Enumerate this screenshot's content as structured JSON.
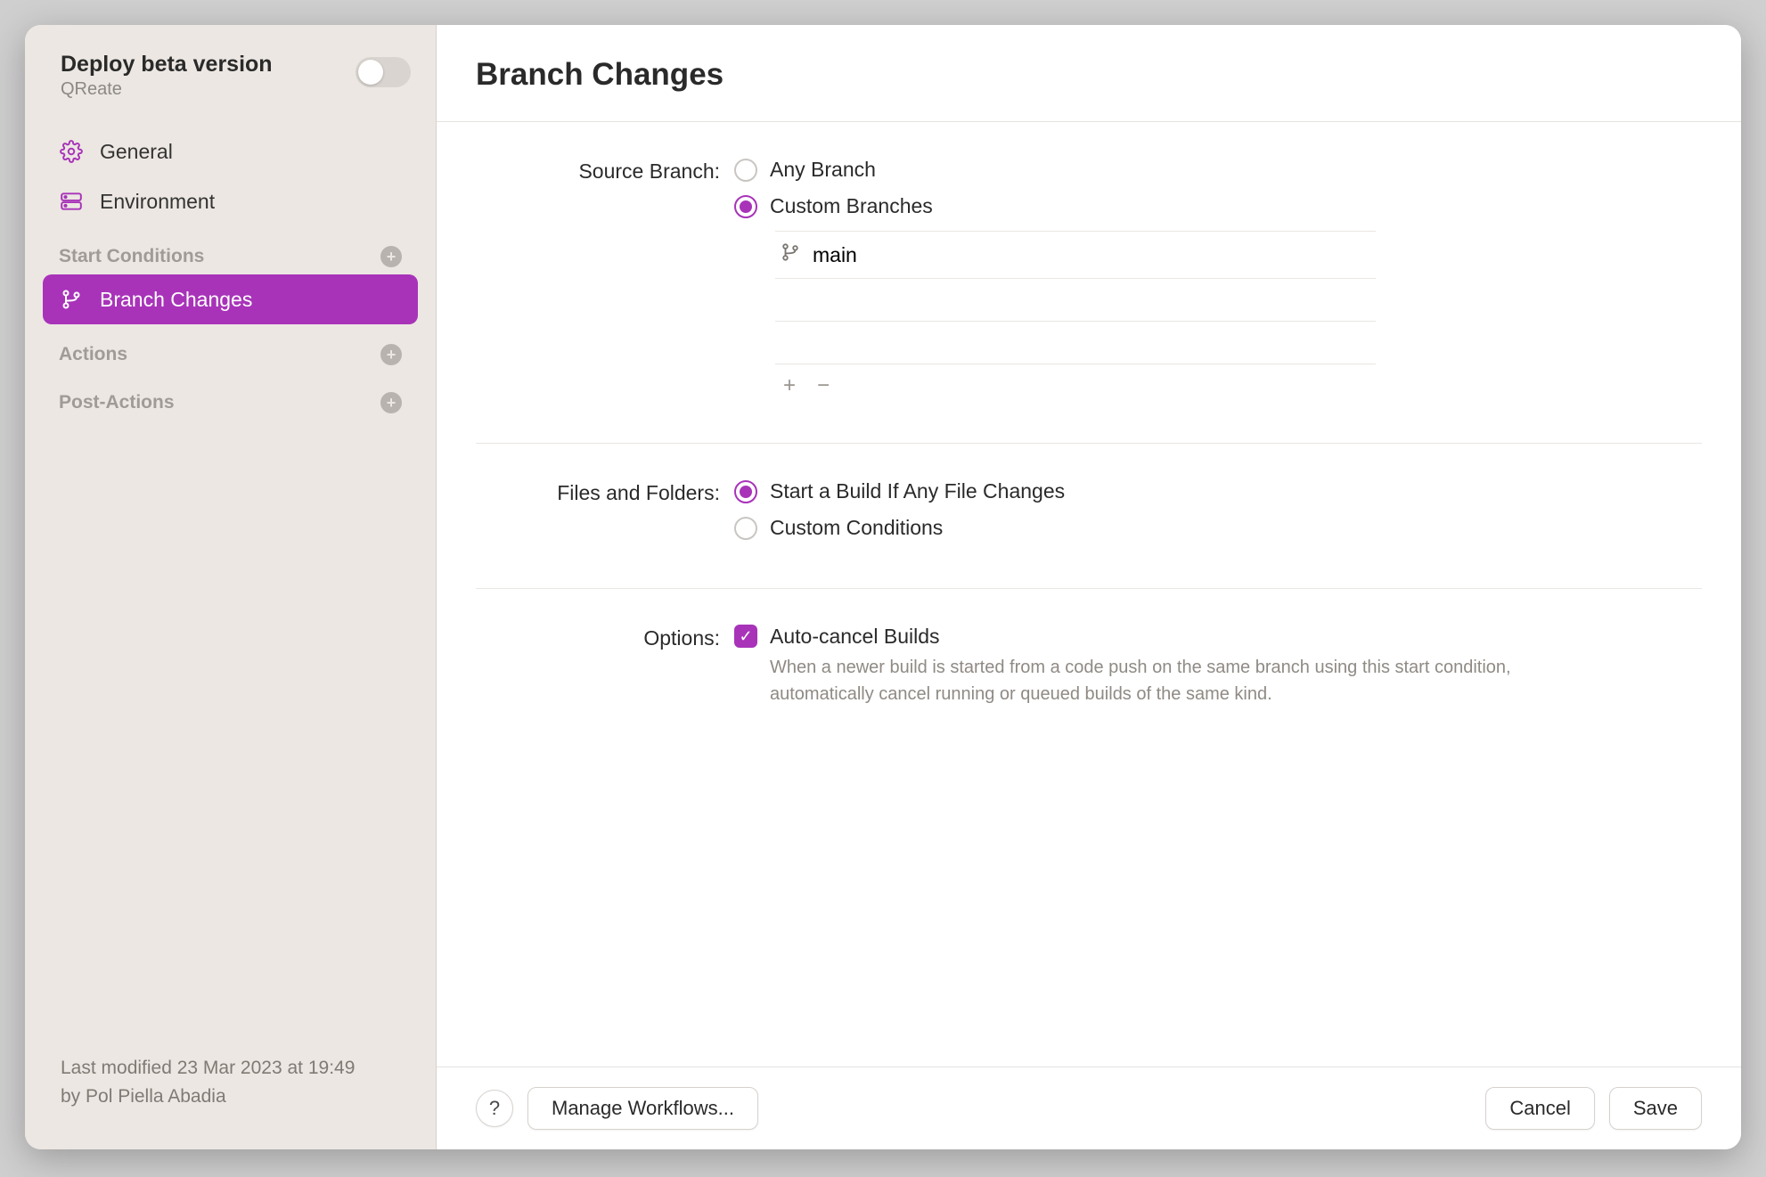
{
  "sidebar": {
    "title": "Deploy beta version",
    "subtitle": "QReate",
    "nav": {
      "general": "General",
      "environment": "Environment"
    },
    "sections": {
      "start_conditions": "Start Conditions",
      "branch_changes": "Branch Changes",
      "actions": "Actions",
      "post_actions": "Post-Actions"
    },
    "footer_line1": "Last modified 23 Mar 2023 at 19:49",
    "footer_line2": "by Pol Piella Abadia"
  },
  "main": {
    "title": "Branch Changes",
    "source_branch": {
      "label": "Source Branch:",
      "any": "Any Branch",
      "custom": "Custom Branches",
      "branches": [
        "main"
      ]
    },
    "files_folders": {
      "label": "Files and Folders:",
      "any_file": "Start a Build If Any File Changes",
      "custom": "Custom Conditions"
    },
    "options": {
      "label": "Options:",
      "autocancel_title": "Auto-cancel Builds",
      "autocancel_desc": "When a newer build is started from a code push on the same branch using this start condition, automatically cancel running or queued builds of the same kind."
    }
  },
  "footer": {
    "help": "?",
    "manage": "Manage Workflows...",
    "cancel": "Cancel",
    "save": "Save"
  },
  "colors": {
    "accent": "#a833b9"
  }
}
